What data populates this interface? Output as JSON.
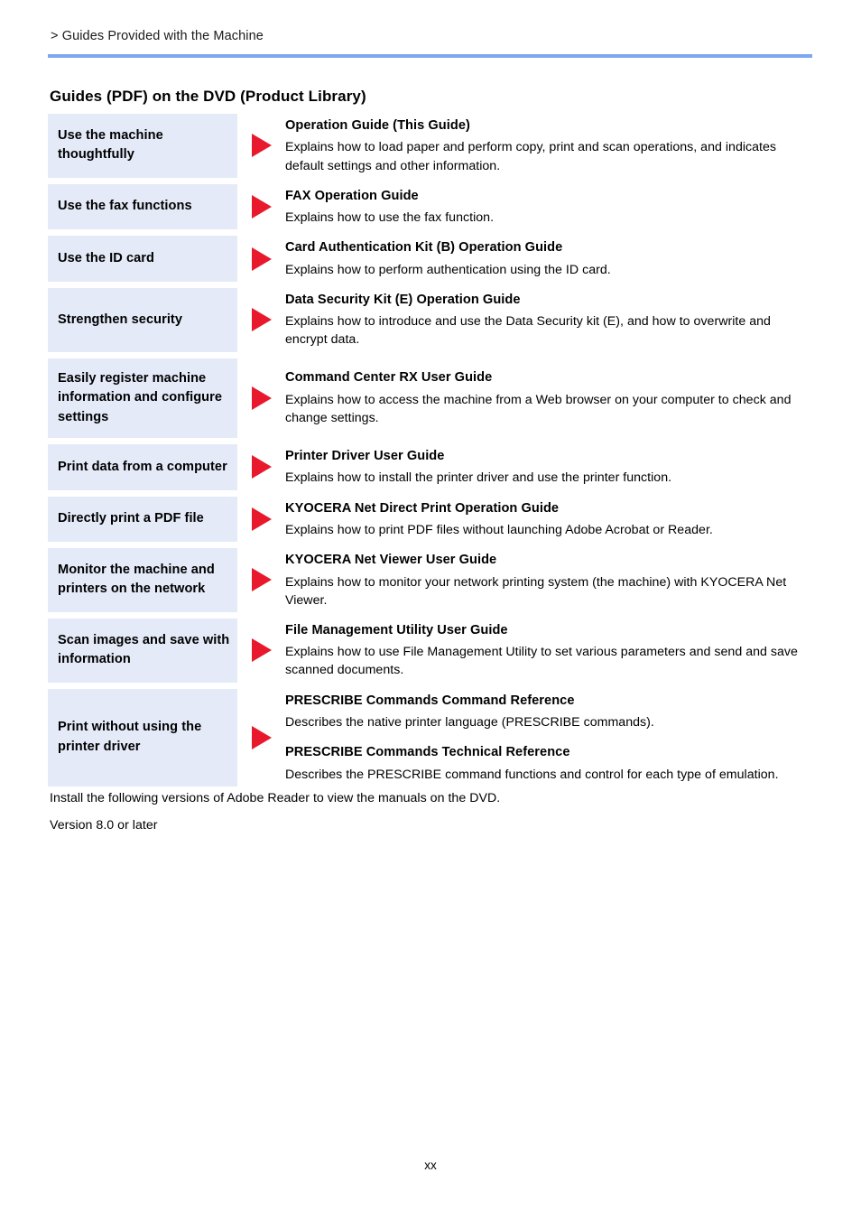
{
  "page": {
    "breadcrumb": "> Guides Provided with the Machine",
    "section_title": "Guides (PDF) on the DVD (Product Library)",
    "page_number": "xx",
    "rule_color": "#7da7f0",
    "topic_box_color": "#e4eaf8",
    "arrow_color": "#e8192c"
  },
  "rows": [
    {
      "topic": "Use the machine thoughtfully",
      "entries": [
        {
          "title": "Operation Guide (This Guide)",
          "description": "Explains how to load paper and perform copy, print and scan operations, and indicates default settings and other information."
        }
      ]
    },
    {
      "topic": "Use the fax functions",
      "entries": [
        {
          "title": "FAX Operation Guide",
          "description": "Explains how to use the fax function."
        }
      ]
    },
    {
      "topic": "Use the ID card",
      "entries": [
        {
          "title": "Card Authentication Kit (B) Operation Guide",
          "description": "Explains how to perform authentication using the ID card."
        }
      ]
    },
    {
      "topic": "Strengthen security",
      "entries": [
        {
          "title": "Data Security Kit (E) Operation Guide",
          "description": "Explains how to introduce and use the Data Security kit (E), and how to overwrite and encrypt data."
        }
      ]
    },
    {
      "topic": "Easily register machine information and configure settings",
      "entries": [
        {
          "title": "Command Center RX User Guide",
          "description": "Explains how to access the machine from a Web browser on your computer to check and change settings."
        }
      ]
    },
    {
      "topic": "Print data from a computer",
      "entries": [
        {
          "title": "Printer Driver User Guide",
          "description": "Explains how to install the printer driver and use the printer function."
        }
      ]
    },
    {
      "topic": "Directly print a PDF file",
      "entries": [
        {
          "title": "KYOCERA Net Direct Print Operation Guide",
          "description": "Explains how to print PDF files without launching Adobe Acrobat or Reader."
        }
      ]
    },
    {
      "topic": "Monitor the machine and printers on the network",
      "entries": [
        {
          "title": "KYOCERA Net Viewer User Guide",
          "description": "Explains how to monitor your network printing system (the machine) with KYOCERA Net Viewer."
        }
      ]
    },
    {
      "topic": "Scan images and save with information",
      "entries": [
        {
          "title": "File Management Utility User Guide",
          "description": "Explains how to use File Management Utility to set various parameters and send and save scanned documents."
        }
      ]
    },
    {
      "topic": "Print without using the printer driver",
      "entries": [
        {
          "title": "PRESCRIBE Commands Command Reference",
          "description": "Describes the native printer language (PRESCRIBE commands)."
        },
        {
          "title": "PRESCRIBE Commands Technical Reference",
          "description": "Describes the PRESCRIBE command functions and control for each type of emulation."
        }
      ]
    }
  ],
  "notes": {
    "install": "Install the following versions of Adobe Reader to view the manuals on the DVD.",
    "version": "Version 8.0 or later"
  }
}
